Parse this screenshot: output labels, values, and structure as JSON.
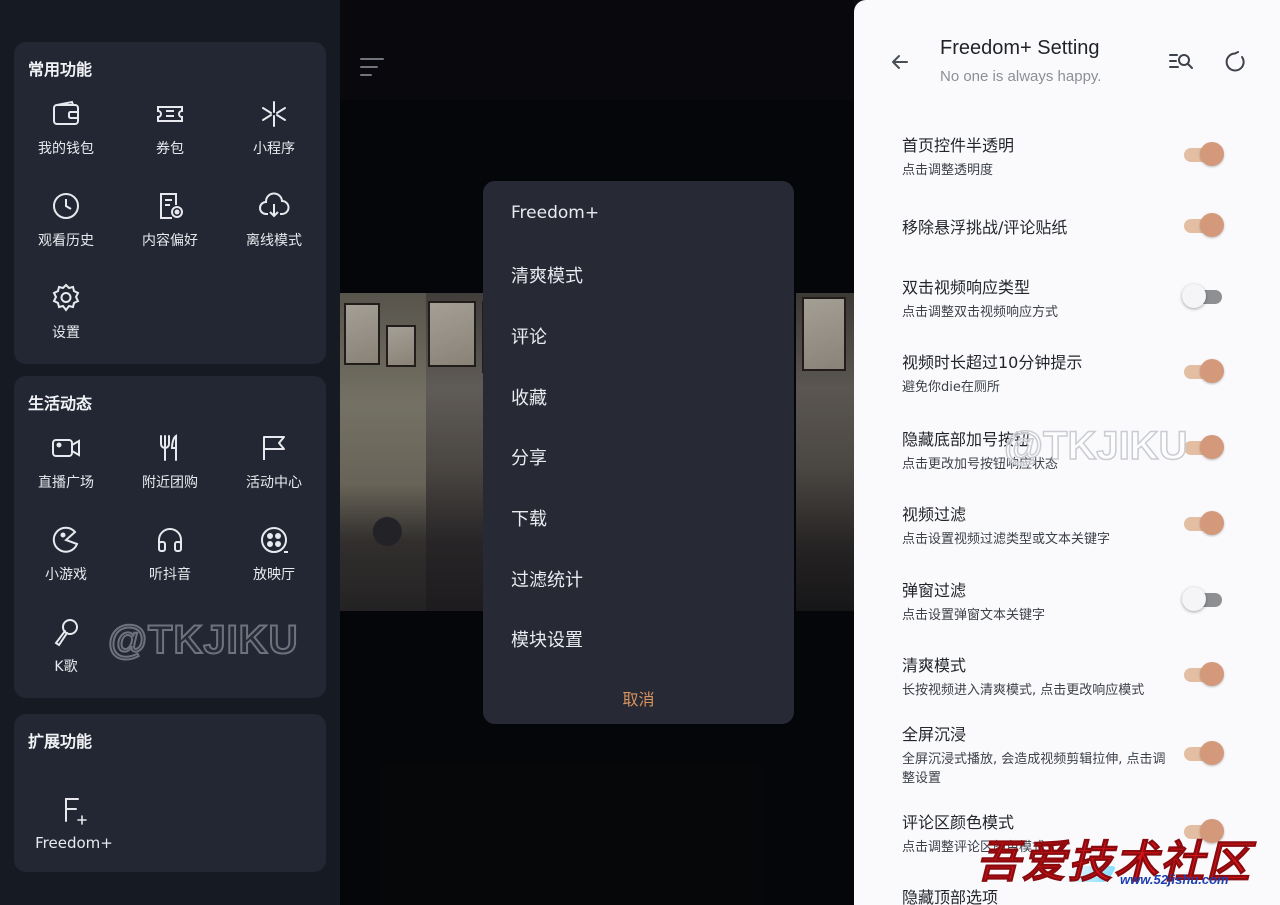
{
  "left": {
    "sections": [
      {
        "title": "常用功能",
        "items": [
          {
            "label": "我的钱包",
            "icon": "wallet-icon"
          },
          {
            "label": "券包",
            "icon": "coupon-icon"
          },
          {
            "label": "小程序",
            "icon": "mini-program-icon"
          },
          {
            "label": "观看历史",
            "icon": "clock-icon"
          },
          {
            "label": "内容偏好",
            "icon": "preference-icon"
          },
          {
            "label": "离线模式",
            "icon": "cloud-download-icon"
          },
          {
            "label": "设置",
            "icon": "gear-icon"
          }
        ]
      },
      {
        "title": "生活动态",
        "items": [
          {
            "label": "直播广场",
            "icon": "live-camera-icon"
          },
          {
            "label": "附近团购",
            "icon": "fork-knife-icon"
          },
          {
            "label": "活动中心",
            "icon": "flag-icon"
          },
          {
            "label": "小游戏",
            "icon": "game-icon"
          },
          {
            "label": "听抖音",
            "icon": "headphones-icon"
          },
          {
            "label": "放映厅",
            "icon": "film-reel-icon"
          },
          {
            "label": "K歌",
            "icon": "microphone-icon"
          }
        ]
      },
      {
        "title": "扩展功能",
        "items": [
          {
            "label": "Freedom+",
            "icon": "freedom-plus-icon"
          }
        ]
      }
    ],
    "watermark": "@TKJIKU"
  },
  "popup": {
    "title": "Freedom+",
    "items": [
      "清爽模式",
      "评论",
      "收藏",
      "分享",
      "下载",
      "过滤统计",
      "模块设置"
    ],
    "cancel": "取消",
    "cancel_color": "#d9935e"
  },
  "settings": {
    "title": "Freedom+ Setting",
    "subtitle": "No one is always happy.",
    "accent": "#d4997a",
    "rows": [
      {
        "title": "首页控件半透明",
        "desc": "点击调整透明度",
        "on": true
      },
      {
        "title": "移除悬浮挑战/评论贴纸",
        "desc": "",
        "on": true
      },
      {
        "title": "双击视频响应类型",
        "desc": "点击调整双击视频响应方式",
        "on": false
      },
      {
        "title": "视频时长超过10分钟提示",
        "desc": "避免你die在厕所",
        "on": true
      },
      {
        "title": "隐藏底部加号按钮",
        "desc": "点击更改加号按钮响应状态",
        "on": true
      },
      {
        "title": "视频过滤",
        "desc": "点击设置视频过滤类型或文本关键字",
        "on": true
      },
      {
        "title": "弹窗过滤",
        "desc": "点击设置弹窗文本关键字",
        "on": false
      },
      {
        "title": "清爽模式",
        "desc": "长按视频进入清爽模式, 点击更改响应模式",
        "on": true
      },
      {
        "title": "全屏沉浸",
        "desc": "全屏沉浸式播放, 会造成视频剪辑拉伸, 点击调整设置",
        "on": true
      },
      {
        "title": "评论区颜色模式",
        "desc": "点击调整评论区颜色模式",
        "on": true
      },
      {
        "title": "隐藏顶部选项",
        "desc": "",
        "on": false
      }
    ],
    "watermark": "@TKJIKU"
  },
  "site_logo": {
    "text": "吾爱技术社区",
    "url": "www.52jishu.com"
  }
}
